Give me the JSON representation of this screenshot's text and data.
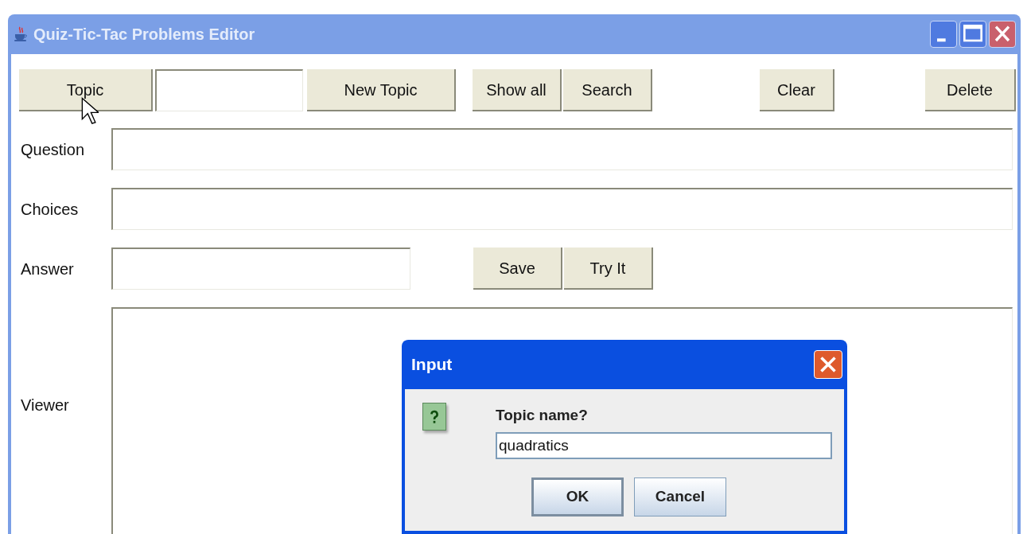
{
  "window": {
    "title": "Quiz-Tic-Tac Problems Editor"
  },
  "toolbar": [
    {
      "kind": "button",
      "label": "Topic"
    },
    {
      "kind": "field"
    },
    {
      "kind": "button",
      "label": "New Topic"
    },
    {
      "kind": "button",
      "label": "Show all"
    },
    {
      "kind": "button",
      "label": "Search"
    },
    {
      "kind": "button",
      "label": "Clear"
    },
    {
      "kind": "button",
      "label": "Delete"
    }
  ],
  "form": [
    {
      "kind": "line",
      "label": "Question"
    },
    {
      "kind": "line",
      "label": "Choices"
    },
    {
      "kind": "short",
      "label": "Answer",
      "buttons": [
        "Save",
        "Try It"
      ]
    },
    {
      "kind": "area",
      "label": "Viewer"
    }
  ],
  "dialog": {
    "title": "Input",
    "prompt": "Topic name?",
    "value": "quadratics",
    "buttons": [
      {
        "label": "OK",
        "focused": true
      },
      {
        "label": "Cancel",
        "focused": false
      }
    ]
  }
}
